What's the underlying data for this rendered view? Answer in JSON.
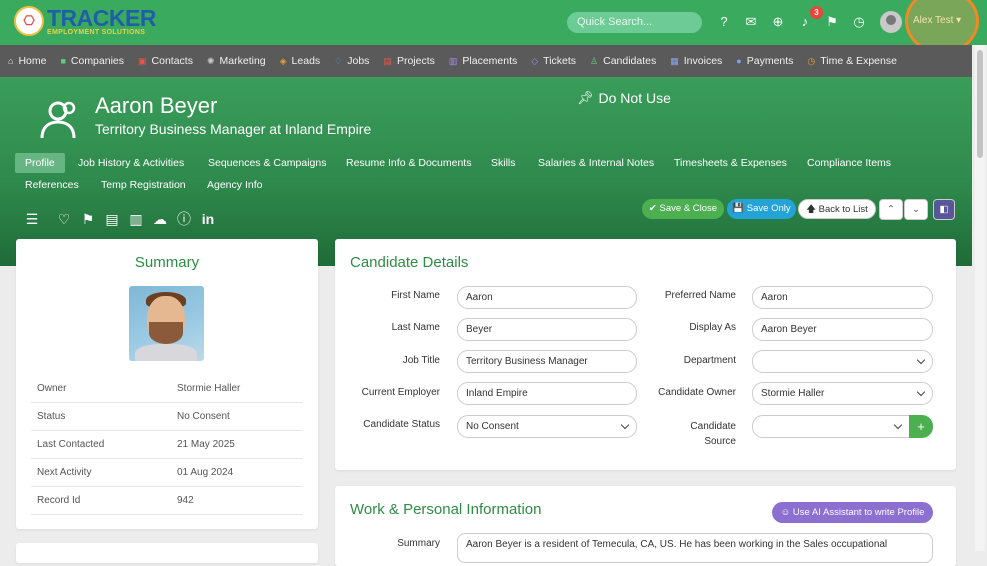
{
  "app": {
    "logo_main": "TRACKER",
    "logo_sub": "EMPLOYMENT SOLUTIONS",
    "search_placeholder": "Quick Search...",
    "notifications_count": "3",
    "user_name": "Alex Test",
    "icons": [
      "help-icon",
      "chat-icon",
      "add-circle-icon",
      "bell-icon",
      "flag-icon",
      "history-icon"
    ]
  },
  "nav": [
    {
      "label": "Home",
      "icon": "home-icon",
      "glyph": "⌂",
      "color": "#e0e0e0"
    },
    {
      "label": "Companies",
      "icon": "building-icon",
      "glyph": "■",
      "color": "#5fcf7a"
    },
    {
      "label": "Contacts",
      "icon": "contact-icon",
      "glyph": "▣",
      "color": "#e8564a"
    },
    {
      "label": "Marketing",
      "icon": "megaphone-icon",
      "glyph": "✺",
      "color": "#c8c8c8"
    },
    {
      "label": "Leads",
      "icon": "target-icon",
      "glyph": "◈",
      "color": "#f0a03a"
    },
    {
      "label": "Jobs",
      "icon": "jobs-icon",
      "glyph": "♢",
      "color": "#57a3ef"
    },
    {
      "label": "Projects",
      "icon": "folder-icon",
      "glyph": "▤",
      "color": "#e8564a"
    },
    {
      "label": "Placements",
      "icon": "briefcase-icon",
      "glyph": "▥",
      "color": "#a48de8"
    },
    {
      "label": "Tickets",
      "icon": "ticket-icon",
      "glyph": "◇",
      "color": "#a48de8"
    },
    {
      "label": "Candidates",
      "icon": "candidate-icon",
      "glyph": "♙",
      "color": "#5fcf7a"
    },
    {
      "label": "Invoices",
      "icon": "invoice-icon",
      "glyph": "▦",
      "color": "#8aa8f0"
    },
    {
      "label": "Payments",
      "icon": "payment-icon",
      "glyph": "●",
      "color": "#7aa3f0"
    },
    {
      "label": "Time & Expense",
      "icon": "clock-icon",
      "glyph": "◷",
      "color": "#f0a03a"
    }
  ],
  "candidate": {
    "name": "Aaron Beyer",
    "subtitle": "Territory Business Manager at Inland Empire",
    "flag": "Do Not Use"
  },
  "tabs": [
    {
      "label": "Profile",
      "active": true
    },
    {
      "label": "Job History & Activities"
    },
    {
      "label": "Sequences & Campaigns"
    },
    {
      "label": "Resume Info & Documents"
    },
    {
      "label": "Skills"
    },
    {
      "label": "Salaries & Internal Notes"
    },
    {
      "label": "Timesheets & Expenses"
    },
    {
      "label": "Compliance Items"
    },
    {
      "label": "References"
    },
    {
      "label": "Temp Registration"
    },
    {
      "label": "Agency Info"
    }
  ],
  "actions": {
    "save_close": "✔ Save & Close",
    "save_only": "💾 Save Only",
    "back_to_list": "🡅 Back to List"
  },
  "summary": {
    "title": "Summary",
    "rows": [
      {
        "key": "Owner",
        "value": "Stormie Haller"
      },
      {
        "key": "Status",
        "value": "No Consent"
      },
      {
        "key": "Last Contacted",
        "value": "21 May 2025"
      },
      {
        "key": "Next Activity",
        "value": "01 Aug 2024"
      },
      {
        "key": "Record Id",
        "value": "942"
      }
    ]
  },
  "details": {
    "title": "Candidate Details",
    "first_name_label": "First Name",
    "first_name": "Aaron",
    "preferred_name_label": "Preferred Name",
    "preferred_name": "Aaron",
    "last_name_label": "Last Name",
    "last_name": "Beyer",
    "display_as_label": "Display As",
    "display_as": "Aaron Beyer",
    "job_title_label": "Job Title",
    "job_title": "Territory Business Manager",
    "department_label": "Department",
    "department": "",
    "current_employer_label": "Current Employer",
    "current_employer": "Inland Empire",
    "candidate_owner_label": "Candidate Owner",
    "candidate_owner": "Stormie Haller",
    "candidate_status_label": "Candidate Status",
    "candidate_status": "No Consent",
    "candidate_source_label_1": "Candidate",
    "candidate_source_label_2": "Source",
    "candidate_source": ""
  },
  "work": {
    "title": "Work & Personal Information",
    "ai_button": "Use AI Assistant to write Profile",
    "summary_label": "Summary",
    "summary_text": "Aaron Beyer is a resident of Temecula, CA, US. He has been working in the Sales occupational"
  }
}
